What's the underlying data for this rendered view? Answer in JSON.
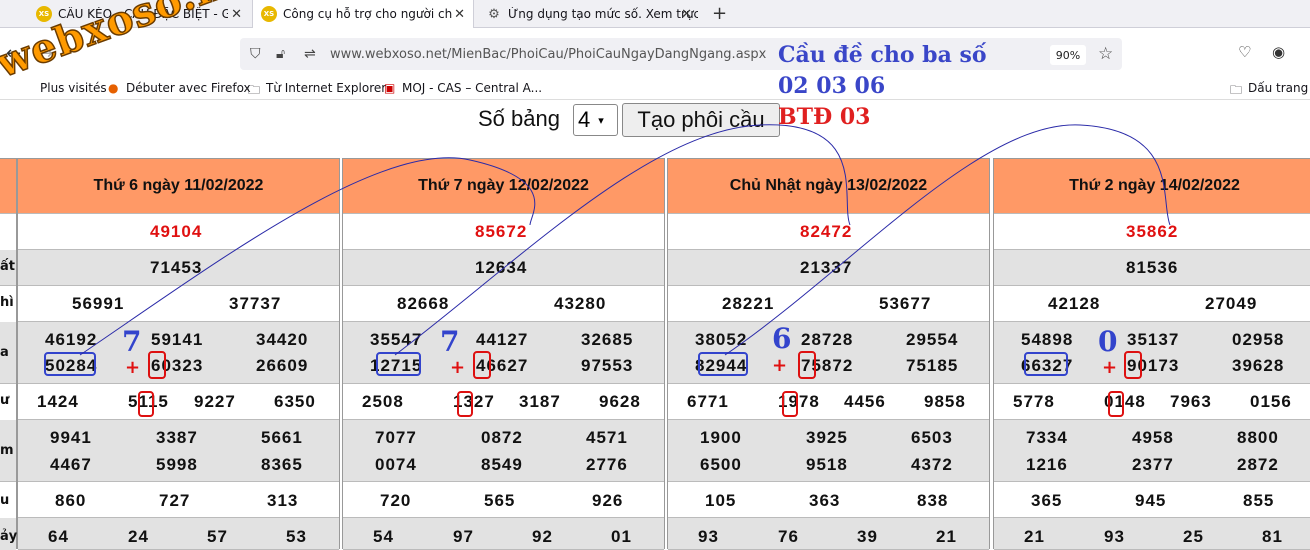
{
  "tabs": [
    {
      "label": "CẦU KÈO - CẦU ĐẶC BIỆT - GÀ",
      "favicon": "XS"
    },
    {
      "label": "Công cụ hỗ trợ cho người chơi",
      "favicon": "XS"
    },
    {
      "label": "Ứng dụng tạo mức số. Xem trực",
      "favicon": "gear-icon"
    }
  ],
  "address": {
    "url": "www.webxoso.net/MienBac/PhoiCau/PhoiCauNgayDangNgang.aspx",
    "zoom": "90%"
  },
  "bookmarks": [
    {
      "label": "Plus visités"
    },
    {
      "label": "Débuter avec Firefox"
    },
    {
      "label": "Từ Internet Explorer"
    },
    {
      "label": "MOJ - CAS – Central A..."
    },
    {
      "label": "Dấu trang k"
    }
  ],
  "logo_text": "webxoso.net",
  "controls": {
    "so_bang_label": "Số bảng",
    "so_bang_value": "4",
    "tao_button": "Tạo phôi cầu"
  },
  "annotation": {
    "line1": "Cầu đề cho ba số",
    "line2": "02 03 06",
    "line3": "BTĐ 03"
  },
  "side_labels": [
    "ất",
    "hì",
    "a",
    "ư",
    "m",
    "u",
    "ảy"
  ],
  "boards": [
    {
      "title": "Thứ 6 ngày 11/02/2022",
      "db": "49104",
      "nhat": "71453",
      "nhi": [
        "56991",
        "37737"
      ],
      "ba": [
        "46192",
        "59141",
        "34420",
        "50284",
        "60323",
        "26609"
      ],
      "tu": [
        "1424",
        "5115",
        "9227",
        "6350"
      ],
      "nam": [
        "9941",
        "3387",
        "5661",
        "4467",
        "5998",
        "8365"
      ],
      "sau": [
        "860",
        "727",
        "313"
      ],
      "bay": [
        "64",
        "24",
        "57",
        "53"
      ],
      "marker": "7"
    },
    {
      "title": "Thứ 7 ngày 12/02/2022",
      "db": "85672",
      "nhat": "12634",
      "nhi": [
        "82668",
        "43280"
      ],
      "ba": [
        "35547",
        "44127",
        "32685",
        "12715",
        "46627",
        "97553"
      ],
      "tu": [
        "2508",
        "1327",
        "3187",
        "9628"
      ],
      "nam": [
        "7077",
        "0872",
        "4571",
        "0074",
        "8549",
        "2776"
      ],
      "sau": [
        "720",
        "565",
        "926"
      ],
      "bay": [
        "54",
        "97",
        "92",
        "01"
      ],
      "marker": "7"
    },
    {
      "title": "Chủ Nhật ngày 13/02/2022",
      "db": "82472",
      "nhat": "21337",
      "nhi": [
        "28221",
        "53677"
      ],
      "ba": [
        "38052",
        "28728",
        "29554",
        "82944",
        "75872",
        "75185"
      ],
      "tu": [
        "6771",
        "1978",
        "4456",
        "9858"
      ],
      "nam": [
        "1900",
        "3925",
        "6503",
        "6500",
        "9518",
        "4372"
      ],
      "sau": [
        "105",
        "363",
        "838"
      ],
      "bay": [
        "93",
        "76",
        "39",
        "21"
      ],
      "marker": "6"
    },
    {
      "title": "Thứ 2 ngày 14/02/2022",
      "db": "35862",
      "nhat": "81536",
      "nhi": [
        "42128",
        "27049"
      ],
      "ba": [
        "54898",
        "35137",
        "02958",
        "66327",
        "90173",
        "39628"
      ],
      "tu": [
        "5778",
        "0148",
        "7963",
        "0156"
      ],
      "nam": [
        "7334",
        "4958",
        "8800",
        "1216",
        "2377",
        "2872"
      ],
      "sau": [
        "365",
        "945",
        "855"
      ],
      "bay": [
        "21",
        "93",
        "25",
        "81"
      ],
      "marker": "0"
    }
  ],
  "plus_sign": "+",
  "colors": {
    "header_bg": "#ff9966",
    "db_text": "#e01010",
    "annot_blue": "#3a46c8",
    "annot_red": "#e02020"
  }
}
